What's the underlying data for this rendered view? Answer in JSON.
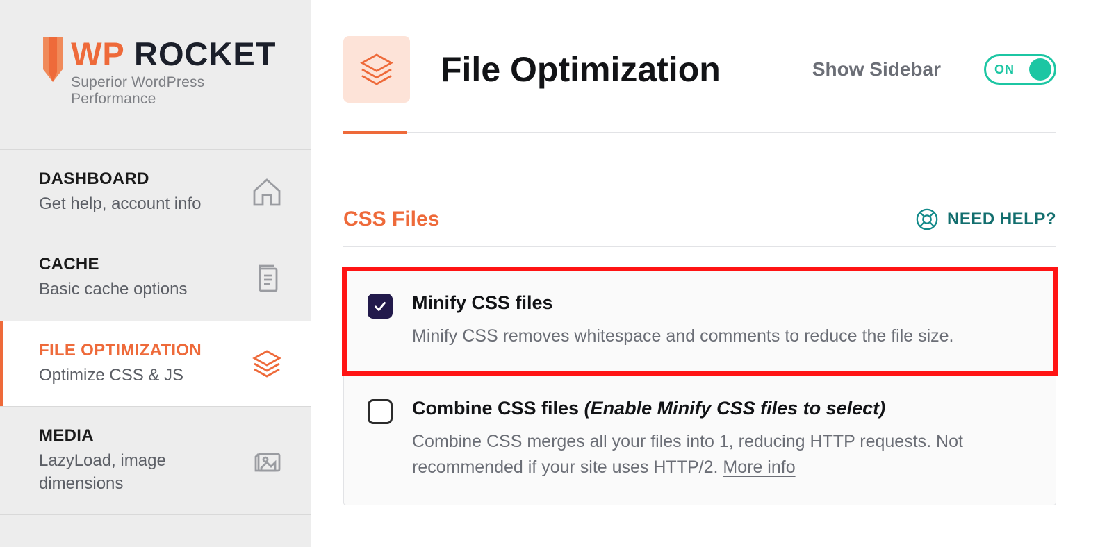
{
  "logo": {
    "wp": "WP",
    "rocket": " ROCKET",
    "tagline": "Superior WordPress Performance"
  },
  "sidebar": {
    "items": [
      {
        "title": "DASHBOARD",
        "desc": "Get help, account info"
      },
      {
        "title": "CACHE",
        "desc": "Basic cache options"
      },
      {
        "title": "FILE OPTIMIZATION",
        "desc": "Optimize CSS & JS"
      },
      {
        "title": "MEDIA",
        "desc": "LazyLoad, image dimensions"
      }
    ]
  },
  "header": {
    "title": "File Optimization",
    "show_sidebar_label": "Show Sidebar",
    "toggle_state": "ON"
  },
  "section": {
    "title": "CSS Files",
    "help_label": "NEED HELP?"
  },
  "options": {
    "minify": {
      "title": "Minify CSS files",
      "desc": "Minify CSS removes whitespace and comments to reduce the file size."
    },
    "combine": {
      "title_main": "Combine CSS files ",
      "title_hint": "(Enable Minify CSS files to select)",
      "desc_part1": "Combine CSS merges all your files into 1, reducing HTTP requests. Not recommended if your site uses HTTP/2. ",
      "more_info": "More info"
    }
  }
}
